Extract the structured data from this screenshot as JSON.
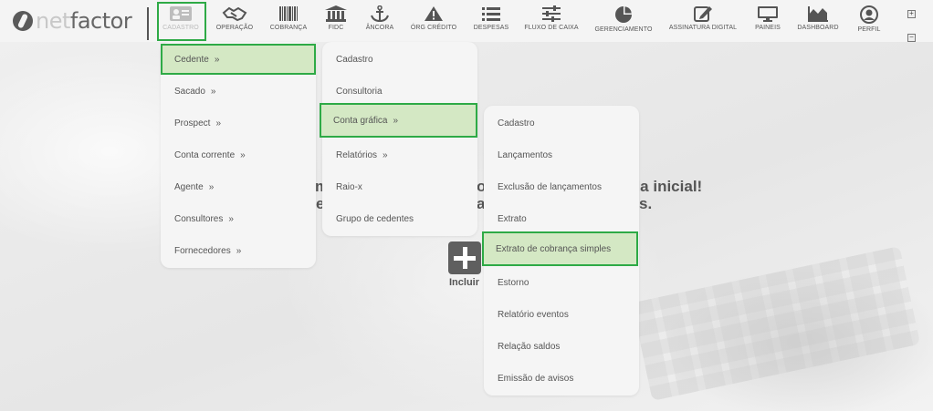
{
  "logo": {
    "text_a": "net",
    "text_b": "factor"
  },
  "nav": [
    {
      "label": "CADASTRO",
      "icon": "id-card-icon"
    },
    {
      "label": "OPERAÇÃO",
      "icon": "handshake-icon"
    },
    {
      "label": "COBRANÇA",
      "icon": "barcode-icon"
    },
    {
      "label": "FIDC",
      "icon": "bank-icon"
    },
    {
      "label": "ÂNCORA",
      "icon": "anchor-icon"
    },
    {
      "label": "ÓRG CRÉDITO",
      "icon": "warning-icon"
    },
    {
      "label": "DESPESAS",
      "icon": "list-icon"
    },
    {
      "label": "FLUXO DE CAIXA",
      "icon": "sliders-icon"
    },
    {
      "label": "GERENCIAMENTO",
      "icon": "pie-chart-icon"
    },
    {
      "label": "ASSINATURA DIGITAL",
      "icon": "signature-icon"
    },
    {
      "label": "PAINEIS",
      "icon": "monitor-icon"
    },
    {
      "label": "DASHBOARD",
      "icon": "area-chart-icon"
    },
    {
      "label": "PERFIL",
      "icon": "user-icon"
    }
  ],
  "window_controls": {
    "expand": "+",
    "collapse": "−"
  },
  "welcome": {
    "line1_left": "m",
    "line1_mid": "o",
    "line1_right": "ela inicial!",
    "line2_left": "e",
    "line2_mid": "a",
    "line2_right": "s."
  },
  "incluir": {
    "label": "Incluir"
  },
  "menu1": [
    {
      "label": "Cedente",
      "chevron": "»",
      "selected": true
    },
    {
      "label": "Sacado",
      "chevron": "»"
    },
    {
      "label": "Prospect",
      "chevron": "»"
    },
    {
      "label": "Conta corrente",
      "chevron": "»"
    },
    {
      "label": "Agente",
      "chevron": "»"
    },
    {
      "label": "Consultores",
      "chevron": "»"
    },
    {
      "label": "Fornecedores",
      "chevron": "»"
    }
  ],
  "menu2": [
    {
      "label": "Cadastro",
      "chevron": ""
    },
    {
      "label": "Consultoria",
      "chevron": ""
    },
    {
      "label": "Conta gráfica",
      "chevron": "»",
      "selected": true
    },
    {
      "label": "Relatórios",
      "chevron": "»"
    },
    {
      "label": "Raio-x",
      "chevron": ""
    },
    {
      "label": "Grupo de cedentes",
      "chevron": ""
    }
  ],
  "menu3": [
    {
      "label": "Cadastro"
    },
    {
      "label": "Lançamentos"
    },
    {
      "label": "Exclusão de lançamentos"
    },
    {
      "label": "Extrato"
    },
    {
      "label": "Extrato de cobrança simples",
      "selected": true
    },
    {
      "label": "Estorno"
    },
    {
      "label": "Relatório eventos"
    },
    {
      "label": "Relação saldos"
    },
    {
      "label": "Emissão de avisos"
    }
  ],
  "colors": {
    "highlight_border": "#2eaa46",
    "selected_bg": "#d4e8c4"
  }
}
